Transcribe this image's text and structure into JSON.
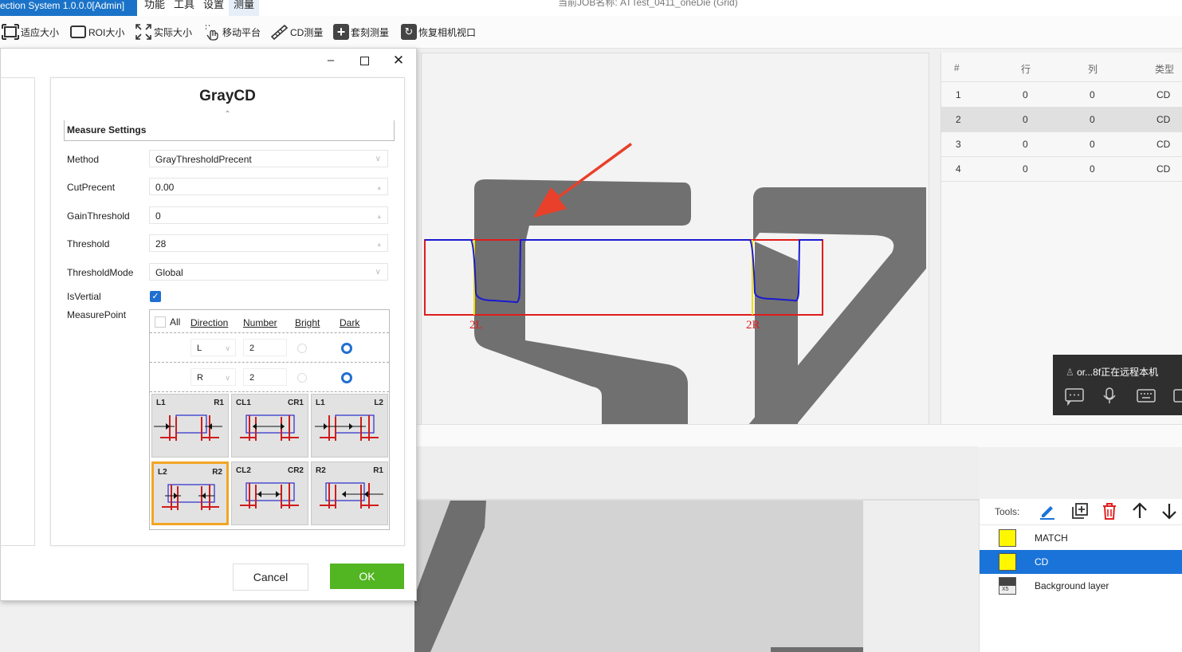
{
  "app": {
    "title": "ection System 1.0.0.0[Admin]",
    "menus": [
      "功能",
      "工具",
      "设置",
      "测量"
    ],
    "job_name": "当前JOB名称: ATTest_0411_oneDie (Grid)"
  },
  "toolbar": [
    {
      "label": "适应大小",
      "icon": "fit-size-icon"
    },
    {
      "label": "ROI大小",
      "icon": "roi-size-icon"
    },
    {
      "label": "实际大小",
      "icon": "actual-size-icon"
    },
    {
      "label": "移动平台",
      "icon": "move-stage-icon"
    },
    {
      "label": "CD测量",
      "icon": "ruler-icon"
    },
    {
      "label": "套刻测量",
      "icon": "plus-icon"
    },
    {
      "label": "恢复相机视口",
      "icon": "refresh-icon"
    }
  ],
  "image": {
    "labels": [
      "2L",
      "2R"
    ]
  },
  "table": {
    "headers": [
      "#",
      "行",
      "列",
      "类型"
    ],
    "rows": [
      {
        "n": "1",
        "row": "0",
        "col": "0",
        "type": "CD"
      },
      {
        "n": "2",
        "row": "0",
        "col": "0",
        "type": "CD"
      },
      {
        "n": "3",
        "row": "0",
        "col": "0",
        "type": "CD"
      },
      {
        "n": "4",
        "row": "0",
        "col": "0",
        "type": "CD"
      }
    ],
    "selected_row": 2
  },
  "remote": {
    "status": "or...8f正在远程本机"
  },
  "layers": {
    "tools_label": "Tools:",
    "items": [
      "MATCH",
      "CD",
      "Background layer"
    ],
    "selected": "CD",
    "thumb_text": "X5"
  },
  "dialog": {
    "title": "GrayCD",
    "section": "Measure Settings",
    "fields": {
      "method_label": "Method",
      "method_value": "GrayThresholdPrecent",
      "cutprecent_label": "CutPrecent",
      "cutprecent_value": "0.00",
      "gain_label": "GainThreshold",
      "gain_value": "0",
      "threshold_label": "Threshold",
      "threshold_value": "28",
      "mode_label": "ThresholdMode",
      "mode_value": "Global",
      "isvertial_label": "IsVertial",
      "isvertial_checked": true,
      "measurepoint_label": "MeasurePoint"
    },
    "measure_point": {
      "headers": {
        "all": "All",
        "direction": "Direction",
        "number": "Number",
        "bright": "Bright",
        "dark": "Dark"
      },
      "rows": [
        {
          "direction": "L",
          "number": "2",
          "selected": "Dark"
        },
        {
          "direction": "R",
          "number": "2",
          "selected": "Dark"
        }
      ],
      "tiles": [
        {
          "left": "L1",
          "right": "R1"
        },
        {
          "left": "CL1",
          "right": "CR1"
        },
        {
          "left": "L1",
          "right": "L2"
        },
        {
          "left": "L2",
          "right": "R2"
        },
        {
          "left": "CL2",
          "right": "CR2"
        },
        {
          "left": "R2",
          "right": "R1"
        }
      ],
      "selected_tile": 3
    },
    "cancel": "Cancel",
    "ok": "OK"
  }
}
